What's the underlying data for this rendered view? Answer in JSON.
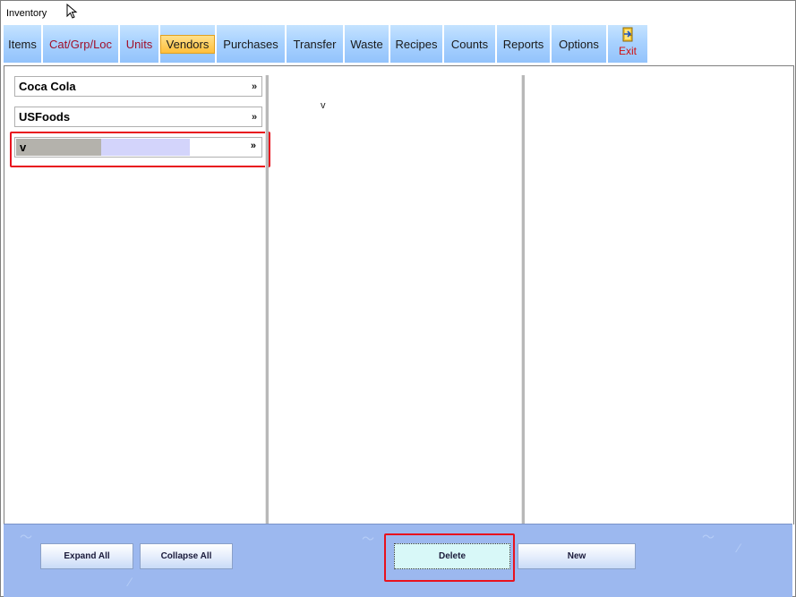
{
  "window": {
    "title": "Inventory"
  },
  "tabs": [
    {
      "label": "Items",
      "color": "normal",
      "width": 44
    },
    {
      "label": "Cat/Grp/Loc",
      "color": "red",
      "width": 86
    },
    {
      "label": "Units",
      "color": "red",
      "width": 45
    },
    {
      "label": "Vendors",
      "color": "normal",
      "width": 63,
      "active": true
    },
    {
      "label": "Purchases",
      "color": "normal",
      "width": 78
    },
    {
      "label": "Transfer",
      "color": "normal",
      "width": 65
    },
    {
      "label": "Waste",
      "color": "normal",
      "width": 51
    },
    {
      "label": "Recipes",
      "color": "normal",
      "width": 60
    },
    {
      "label": "Counts",
      "color": "normal",
      "width": 59
    },
    {
      "label": "Reports",
      "color": "normal",
      "width": 61
    },
    {
      "label": "Options",
      "color": "normal",
      "width": 63
    }
  ],
  "exit": {
    "label": "Exit",
    "icon": "exit-door-icon"
  },
  "vendors": [
    {
      "name": "Coca Cola"
    },
    {
      "name": "USFoods"
    }
  ],
  "new_vendor": {
    "value": "v"
  },
  "middle_panel": {
    "text": "v"
  },
  "buttons": {
    "expand_all": "Expand All",
    "collapse_all": "Collapse All",
    "delete": "Delete",
    "new": "New"
  },
  "colors": {
    "tab_bg": "#a9d2ff",
    "active_tab": "#ffbf3c",
    "bottom_bar": "#9cb8ef",
    "highlight": "#e8121e",
    "red_text": "#a0102a"
  }
}
